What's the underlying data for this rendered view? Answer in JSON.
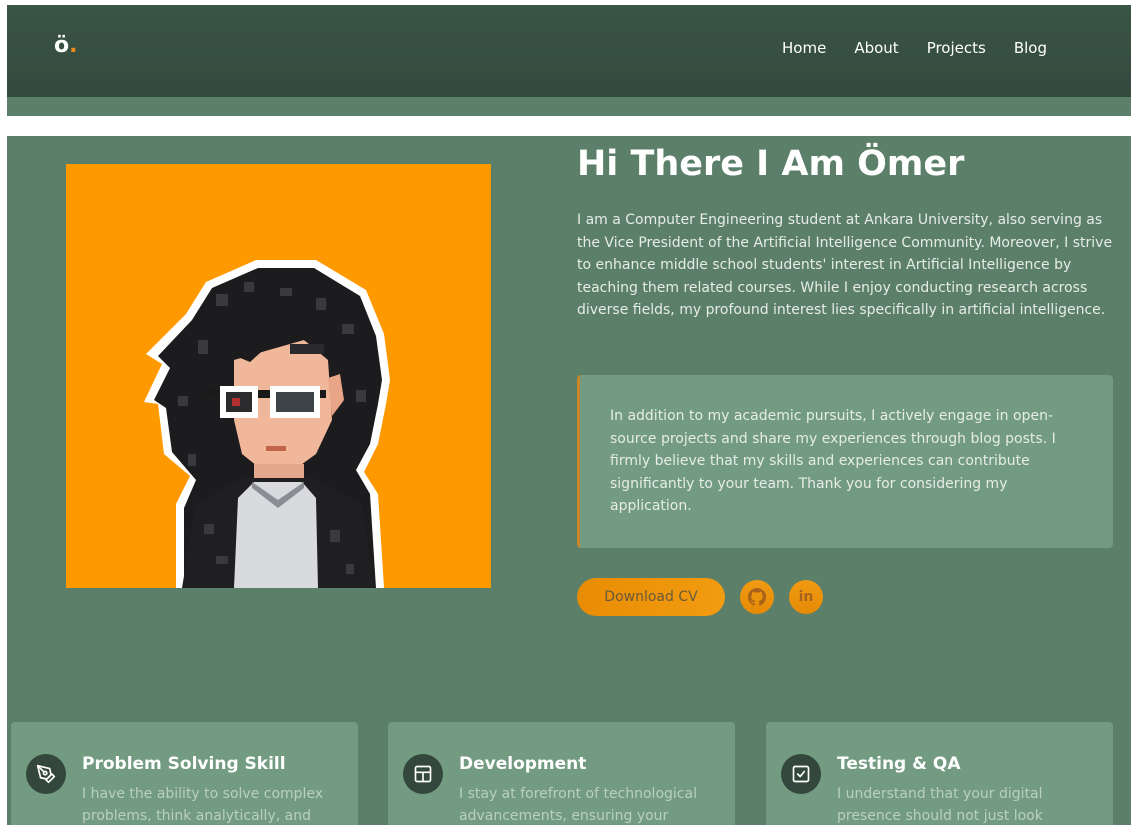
{
  "nav": {
    "logo": "ö",
    "logo_dot": ".",
    "links": [
      "Home",
      "About",
      "Projects",
      "Blog"
    ]
  },
  "hero": {
    "title": "Hi There I Am Ömer",
    "intro": "I am a Computer Engineering student at Ankara University, also serving as the Vice President of the Artificial Intelligence Community. Moreover, I strive to enhance middle school students' interest in Artificial Intelligence by teaching them related courses. While I enjoy conducting research across diverse fields, my profound interest lies specifically in artificial intelligence.",
    "quote": "In addition to my academic pursuits, I actively engage in open-source projects and share my experiences through blog posts. I firmly believe that my skills and experiences can contribute significantly to your team. Thank you for considering my application.",
    "cv_button": "Download CV",
    "socials": [
      {
        "icon": "github-icon"
      },
      {
        "icon": "linkedin-icon",
        "label": "in"
      }
    ]
  },
  "cards": [
    {
      "icon": "pen-tool-icon",
      "title": "Problem Solving Skill",
      "text": "I have the ability to solve complex problems, think analytically, and"
    },
    {
      "icon": "layout-icon",
      "title": "Development",
      "text": "I stay at forefront of technological advancements, ensuring your"
    },
    {
      "icon": "checkbox-icon",
      "title": "Testing & QA",
      "text": "I understand that your digital presence should not just look"
    }
  ],
  "colors": {
    "nav_bg": "#364f41",
    "main_bg": "#5b7f68",
    "card_bg": "#739b82",
    "accent": "#f29c10",
    "avatar_bg": "#ff9900"
  }
}
